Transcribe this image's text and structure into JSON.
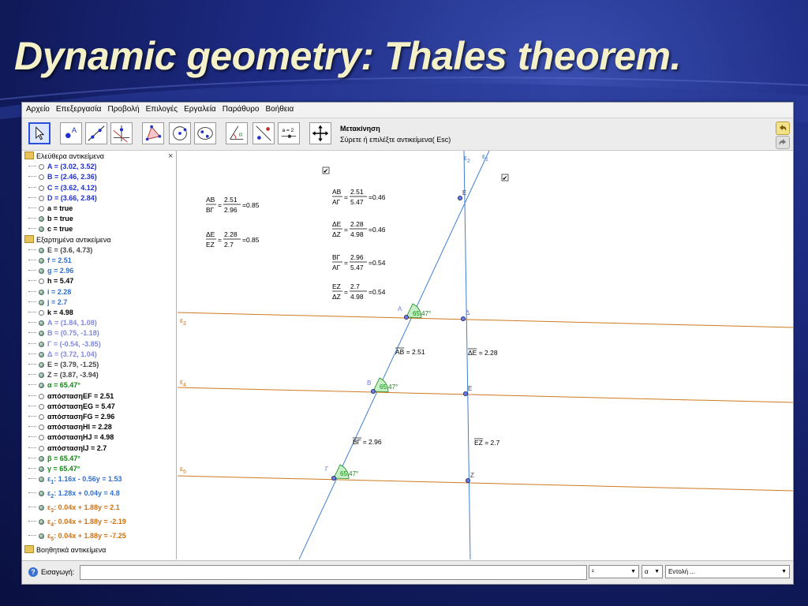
{
  "slide": {
    "title": "Dynamic geometry: Thales theorem."
  },
  "menu": [
    "Αρχείο",
    "Επεξεργασία",
    "Προβολή",
    "Επιλογές",
    "Εργαλεία",
    "Παράθυρο",
    "Βοήθεια"
  ],
  "toolbar": {
    "tools": [
      "move-tool",
      "point-tool",
      "line-tool",
      "perpendicular-tool",
      "polygon-tool",
      "circle-tool",
      "conic-tool",
      "angle-tool",
      "reflect-tool",
      "slider-tool",
      "move-view-tool"
    ],
    "slider_label": "a = 2",
    "tool_name": "Μετακίνηση",
    "tool_help": "Σύρετε ή επιλέξτε αντικείμενα( Esc)"
  },
  "algebra": {
    "close": "×",
    "free_header": "Ελεύθερα αντικείμενα",
    "dependent_header": "Εξαρτημένα αντικείμενα",
    "auxiliary_header": "Βοηθητικά αντικείμενα",
    "free": [
      {
        "text": "A = (3.02, 3.52)",
        "color": "#1f2fd0",
        "shown": false
      },
      {
        "text": "B = (2.46, 2.36)",
        "color": "#1f2fd0",
        "shown": false
      },
      {
        "text": "C = (3.62, 4.12)",
        "color": "#1f2fd0",
        "shown": false
      },
      {
        "text": "D = (3.66, 2.84)",
        "color": "#1f2fd0",
        "shown": false
      },
      {
        "text": "a = true",
        "color": "#000000",
        "shown": false
      },
      {
        "text": "b = true",
        "color": "#000000",
        "shown": true
      },
      {
        "text": "c = true",
        "color": "#000000",
        "shown": true
      }
    ],
    "dependent": [
      {
        "text": "E = (3.6, 4.73)",
        "color": "#444444",
        "shown": true
      },
      {
        "text": "f = 2.51",
        "color": "#2f6fd0",
        "shown": true
      },
      {
        "text": "g = 2.96",
        "color": "#2f6fd0",
        "shown": true
      },
      {
        "text": "h = 5.47",
        "color": "#000000",
        "shown": false
      },
      {
        "text": "i = 2.28",
        "color": "#2f6fd0",
        "shown": true
      },
      {
        "text": "j = 2.7",
        "color": "#2f6fd0",
        "shown": true
      },
      {
        "text": "k = 4.98",
        "color": "#000000",
        "shown": false
      },
      {
        "text": "Α = (1.84, 1.08)",
        "color": "#8088e0",
        "shown": true
      },
      {
        "text": "Β = (0.75, -1.18)",
        "color": "#8088e0",
        "shown": true
      },
      {
        "text": "Γ = (-0.54, -3.85)",
        "color": "#8088e0",
        "shown": true
      },
      {
        "text": "Δ = (3.72, 1.04)",
        "color": "#8088e0",
        "shown": true
      },
      {
        "text": "Ε = (3.79, -1.25)",
        "color": "#444444",
        "shown": true
      },
      {
        "text": "Ζ = (3.87, -3.94)",
        "color": "#444444",
        "shown": true
      },
      {
        "text": "α = 65.47°",
        "color": "#108a10",
        "shown": true
      },
      {
        "text": "απόστασηEF = 2.51",
        "color": "#000000",
        "shown": false
      },
      {
        "text": "απόστασηEG = 5.47",
        "color": "#000000",
        "shown": false
      },
      {
        "text": "απόστασηFG = 2.96",
        "color": "#000000",
        "shown": false
      },
      {
        "text": "απόστασηHI = 2.28",
        "color": "#000000",
        "shown": false
      },
      {
        "text": "απόστασηHJ = 4.98",
        "color": "#000000",
        "shown": false
      },
      {
        "text": "απόστασηIJ = 2.7",
        "color": "#000000",
        "shown": false
      },
      {
        "text": "β = 65.47°",
        "color": "#108a10",
        "shown": true
      },
      {
        "text": "γ = 65.47°",
        "color": "#108a10",
        "shown": true
      },
      {
        "text": "ε1: 1.16x - 0.56y = 1.53",
        "color": "#2f6fd0",
        "shown": true
      },
      {
        "text": "ε2: 1.28x + 0.04y = 4.8",
        "color": "#2f6fd0",
        "shown": true
      },
      {
        "text": "ε3: 0.04x + 1.88y = 2.1",
        "color": "#d07010",
        "shown": true
      },
      {
        "text": "ε4: 0.04x + 1.88y = -2.19",
        "color": "#d07010",
        "shown": true
      },
      {
        "text": "ε5: 0.04x + 1.88y = -7.25",
        "color": "#d07010",
        "shown": true
      }
    ]
  },
  "canvas": {
    "ratios_left": [
      {
        "name": "AB / ΒΓ",
        "num": "AB",
        "den": "ΒΓ",
        "nv": "2.51",
        "dv": "2.96",
        "res": "0.85"
      },
      {
        "name": "ΔΕ / ΕΖ",
        "num": "ΔΕ",
        "den": "ΕΖ",
        "nv": "2.28",
        "dv": "2.7",
        "res": "0.85"
      }
    ],
    "ratios_right": [
      {
        "name": "AB / ΑΓ",
        "num": "AB",
        "den": "ΑΓ",
        "nv": "2.51",
        "dv": "5.47",
        "res": "0.46"
      },
      {
        "name": "ΔΕ / ΔΖ",
        "num": "ΔΕ",
        "den": "ΔΖ",
        "nv": "2.28",
        "dv": "4.98",
        "res": "0.46"
      },
      {
        "name": "ΒΓ / ΑΓ",
        "num": "ΒΓ",
        "den": "ΑΓ",
        "nv": "2.96",
        "dv": "5.47",
        "res": "0.54"
      },
      {
        "name": "ΕΖ / ΔΖ",
        "num": "ΕΖ",
        "den": "ΔΖ",
        "nv": "2.7",
        "dv": "4.98",
        "res": "0.54"
      }
    ],
    "line_labels": {
      "e1": "ε1",
      "e2": "ε2",
      "e3": "ε3",
      "e4": "ε4",
      "e5": "ε5"
    },
    "point_labels": {
      "E": "E",
      "A": "Α",
      "B": "Β",
      "G": "Γ",
      "D": "Δ",
      "EE": "Ε",
      "Z": "Ζ"
    },
    "angle_value": "65.47°",
    "segment_labels": {
      "AB": "AB = 2.51",
      "BG": "ΒΓ = 2.96",
      "DE": "ΔΕ = 2.28",
      "EZ": "ΕΖ = 2.7"
    },
    "checkbox_mark": "✔",
    "colors": {
      "transversal": "#3f7fd0",
      "parallel": "#d07a20",
      "angle_fill": "#c8f0c8",
      "angle_stroke": "#108a10",
      "point_fill": "#6a7ae8",
      "point_stroke": "#202050"
    }
  },
  "inputbar": {
    "label": "Εισαγωγή:",
    "dropdown1": "²",
    "dropdown2": "α",
    "command": "Εντολή ..."
  }
}
